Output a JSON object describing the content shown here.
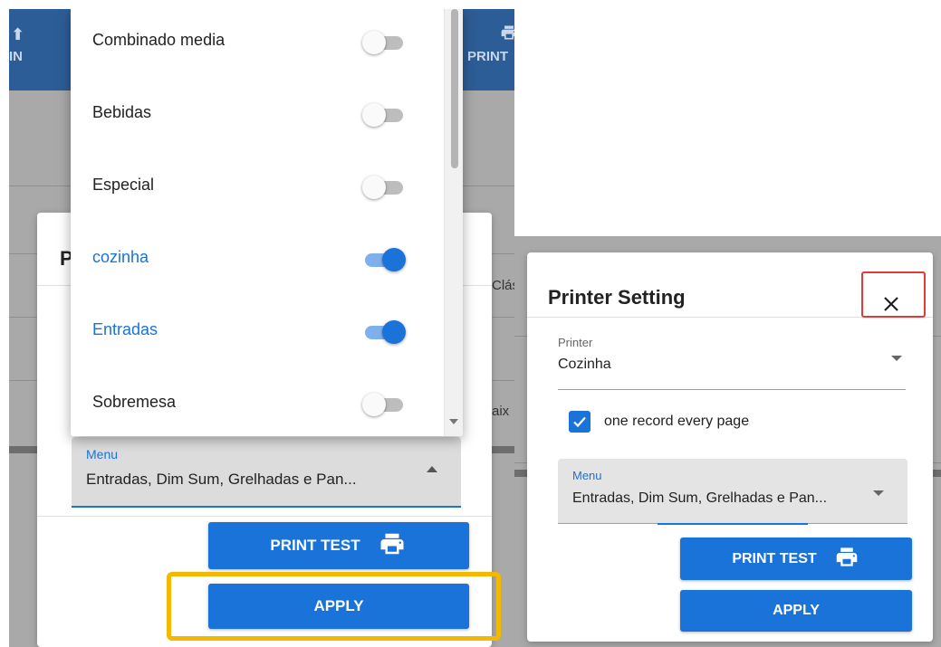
{
  "left_view": {
    "toolbar": {
      "left_button_fragment": "IN",
      "right_button_fragment": "PRINT"
    },
    "background_fragments": [
      "Clás",
      "aix"
    ],
    "dialog_title_fragment": "P",
    "dropdown": {
      "items": [
        {
          "label": "Combinado media",
          "enabled": false
        },
        {
          "label": "Bebidas",
          "enabled": false
        },
        {
          "label": "Especial",
          "enabled": false
        },
        {
          "label": "cozinha",
          "enabled": true
        },
        {
          "label": "Entradas",
          "enabled": true
        },
        {
          "label": "Sobremesa",
          "enabled": false
        }
      ]
    },
    "menu_select": {
      "label": "Menu",
      "value": "Entradas, Dim Sum, Grelhadas e Pan..."
    },
    "print_test_label": "PRINT TEST",
    "apply_label": "APPLY"
  },
  "right_view": {
    "title": "Printer Setting",
    "close_symbol": "✕",
    "printer_field": {
      "label": "Printer",
      "value": "Cozinha"
    },
    "checkbox": {
      "label": "one record every page",
      "checked": true
    },
    "menu_select": {
      "label": "Menu",
      "value": "Entradas, Dim Sum, Grelhadas e Pan..."
    },
    "print_test_label": "PRINT TEST",
    "apply_label": "APPLY"
  },
  "colors": {
    "accent": "#1a73d9",
    "toolbar": "#2d5d97",
    "highlight_apply": "#f5b800",
    "highlight_close": "#e53935"
  }
}
